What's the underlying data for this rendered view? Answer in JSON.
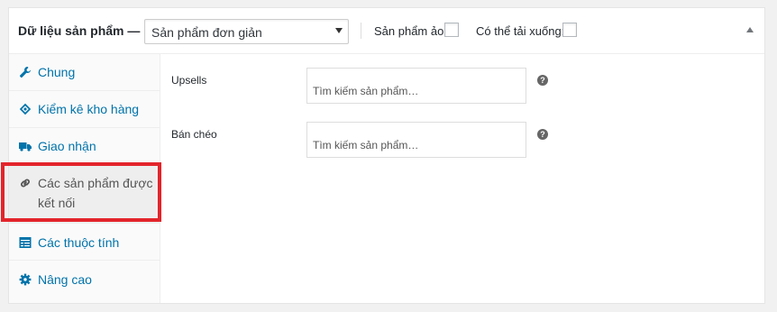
{
  "header": {
    "title": "Dữ liệu sản phẩm —",
    "product_type": {
      "selected": "Sản phẩm đơn giản"
    },
    "virtual_label": "Sản phẩm ảo:",
    "virtual_checked": false,
    "downloadable_label": "Có thể tải xuống:",
    "downloadable_checked": false
  },
  "sidebar": {
    "items": [
      {
        "label": "Chung",
        "icon": "wrench-icon",
        "active": false
      },
      {
        "label": "Kiểm kê kho hàng",
        "icon": "tag-icon",
        "active": false
      },
      {
        "label": "Giao nhận",
        "icon": "truck-icon",
        "active": false
      },
      {
        "label": "Các sản phẩm được",
        "label2": "kết nối",
        "icon": "link-icon",
        "active": true
      },
      {
        "label": "Các thuộc tính",
        "icon": "list-icon",
        "active": false
      },
      {
        "label": "Nâng cao",
        "icon": "gear-icon",
        "active": false
      }
    ]
  },
  "main": {
    "upsells": {
      "label": "Upsells",
      "placeholder": "Tìm kiếm sản phẩm…"
    },
    "cross_sells": {
      "label": "Bán chéo",
      "placeholder": "Tìm kiếm sản phẩm…"
    }
  },
  "colors": {
    "link": "#0073aa",
    "active_bg": "#eeeeee",
    "highlight": "#e3242b"
  }
}
